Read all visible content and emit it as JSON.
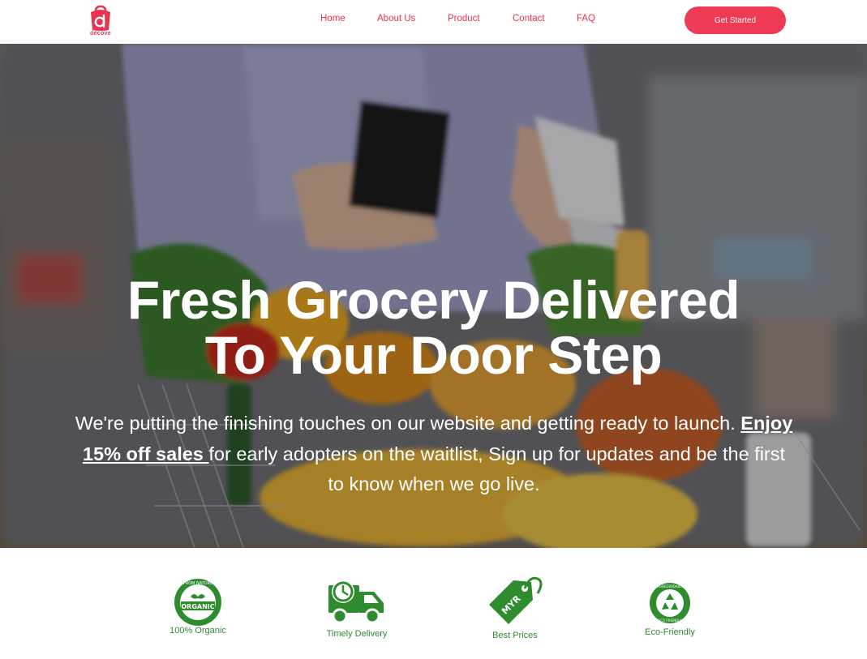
{
  "brand": {
    "name": "décove",
    "accent": "#e8344e"
  },
  "nav": {
    "items": [
      "Home",
      "About Us",
      "Product",
      "Contact",
      "FAQ"
    ],
    "cta_label": "Get Started"
  },
  "hero": {
    "headline_line1": "Fresh Grocery Delivered",
    "headline_line2": "To Your Door Step",
    "sub_before": "We're putting the finishing touches on our website and getting ready to launch. ",
    "sub_promo": "Enjoy 15% off sales ",
    "sub_after": "for early adopters on the waitlist, Sign up for updates and be the first to know when we go live."
  },
  "features": [
    {
      "label": "100% Organic",
      "icon": "organic-badge-icon",
      "badge_text": "ORGANIC",
      "badge_ring": "FROM NATURE"
    },
    {
      "label": "Timely Delivery",
      "icon": "delivery-truck-icon"
    },
    {
      "label": "Best Prices",
      "icon": "price-tag-icon",
      "tag_text": "MYR"
    },
    {
      "label": "Eco-Friendly",
      "icon": "recycle-badge-icon",
      "ring_top": "BIODEGRADABLE",
      "ring_bottom": "ECO FRIENDLY"
    }
  ],
  "colors": {
    "feature_green": "#2e8b2e",
    "cta_bg": "#ee3a52"
  }
}
